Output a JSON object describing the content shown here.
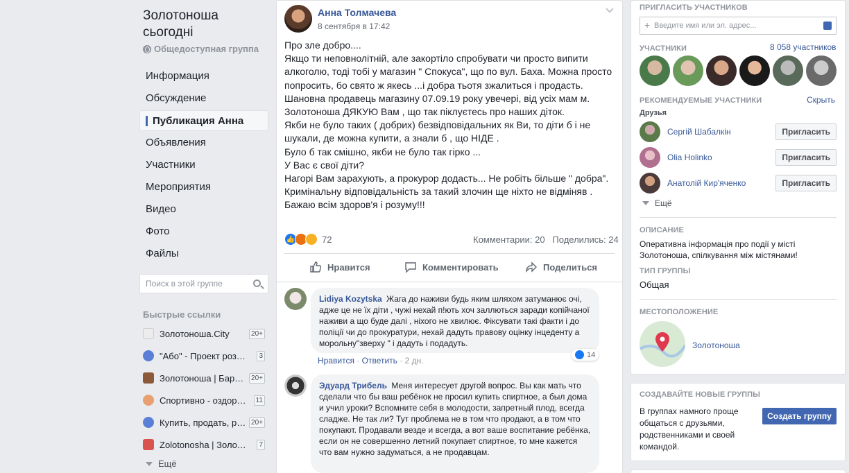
{
  "group": {
    "title": "Золотоноша сьогодні",
    "type": "Общедоступная группа"
  },
  "nav": [
    "Информация",
    "Обсуждение",
    "Публикация Анна",
    "Объявления",
    "Участники",
    "Мероприятия",
    "Видео",
    "Фото",
    "Файлы"
  ],
  "search": {
    "placeholder": "Поиск в этой группе"
  },
  "quick_links": {
    "title": "Быстрые ссылки",
    "items": [
      {
        "label": "Золотоноша.City",
        "count": "20+"
      },
      {
        "label": "\"Або\" - Проект розвитку",
        "count": "3"
      },
      {
        "label": "Золотоноша | Барахолка",
        "count": "20+"
      },
      {
        "label": "Спортивно - оздоровчий",
        "count": "11"
      },
      {
        "label": "Купить, продать, разное",
        "count": "20+"
      },
      {
        "label": "Zolotonosha | Золотоноша",
        "count": "7"
      }
    ],
    "more": "Ещё"
  },
  "post": {
    "author": "Анна Толмачева",
    "date": "8 сентября в 17:42",
    "body": "Про зле добро....\nЯкщо ти неповнолітній, але закортіло спробувати чи просто випити алкоголю, тоді тобі у магазин \" Спокуса\", що по вул. Баха. Можна просто попросить, бо свято ж якесь ...і добра тьотя зжалиться і продасть.\nШановна продавець магазину 07.09.19 року увечері, від усіх мам м. Золотоноша ДЯКУЮ Вам , що так піклуєтесь про наших діток.\nЯкби не було таких ( добрих) безвідповідальних як Ви, то діти б і не шукали, де можна купити, а знали б , що НІДЕ .\nБуло б так смішно, якби не було так гірко ...\nУ Вас є свої діти?\nНагорі Вам зарахують, а прокурор додасть... Не робіть більше \" добра\".\nКримінальну відповідальність за такий злочин ще ніхто не відміняв .\nБажаю всім здоров'я і розуму!!!",
    "reactions_count": "72",
    "comments": "Комментарии: 20",
    "shares": "Поделились: 24",
    "actions": {
      "like": "Нравится",
      "comment": "Комментировать",
      "share": "Поделиться"
    }
  },
  "comments": [
    {
      "name": "Lidiya Kozytska",
      "text": "Жага до наживи будь яким шляхом затуманює очі, адже це не їх діти , чужі нехай п!ють хоч заллються заради копійчаної наживи а що буде далі , ніхого не хвилює. Фіксувати такі факти і до поліції чи до прокуратури, нехай дадуть правову оцінку інцеденту а морольну\"зверху \" і дадуть і подадуть.",
      "like": "Нравится",
      "reply": "Ответить",
      "age": "2 дн.",
      "likes": "14"
    },
    {
      "name": "Эдуард Трибель",
      "text": "Меня интересует другой вопрос. Вы как мать что сделали что бы ваш ребёнок не просил купить спиртное, а был дома и учил уроки? Вспомните себя в молодости, запретный плод, всегда сладже. Не так ли? Тут проблема не в том что продают, а в том что покупают. Продавали везде и всегда, а вот ваше воспитание ребёнка, если он не совершенно летний покупает спиртное, то мне кажется что вам нужно задуматься, а не продавцам."
    }
  ],
  "right": {
    "invite_title": "ПРИГЛАСИТЬ УЧАСТНИКОВ",
    "invite_placeholder": "Введите имя или эл. адрес...",
    "members_title": "УЧАСТНИКИ",
    "members_count": "8 058 участников",
    "recommended_title": "РЕКОМЕНДУЕМЫЕ УЧАСТНИКИ",
    "hide": "Скрыть",
    "friends_label": "Друзья",
    "friends": [
      {
        "name": "Сергій Шабалкін",
        "button": "Пригласить"
      },
      {
        "name": "Olia Holinko",
        "button": "Пригласить"
      },
      {
        "name": "Анатолій Кир'яченко",
        "button": "Пригласить"
      }
    ],
    "more": "Ещё",
    "description_title": "ОПИСАНИЕ",
    "description": "Оперативна інформація про події у місті Золотоноша, спілкування між містянами!",
    "group_type_title": "ТИП ГРУППЫ",
    "group_type": "Общая",
    "location_title": "МЕСТОПОЛОЖЕНИЕ",
    "location": "Золотоноша",
    "create_title": "СОЗДАВАЙТЕ НОВЫЕ ГРУППЫ",
    "create_text": "В группах намного проще общаться с друзьями, родственниками и своей командой.",
    "create_button": "Создать группу"
  }
}
